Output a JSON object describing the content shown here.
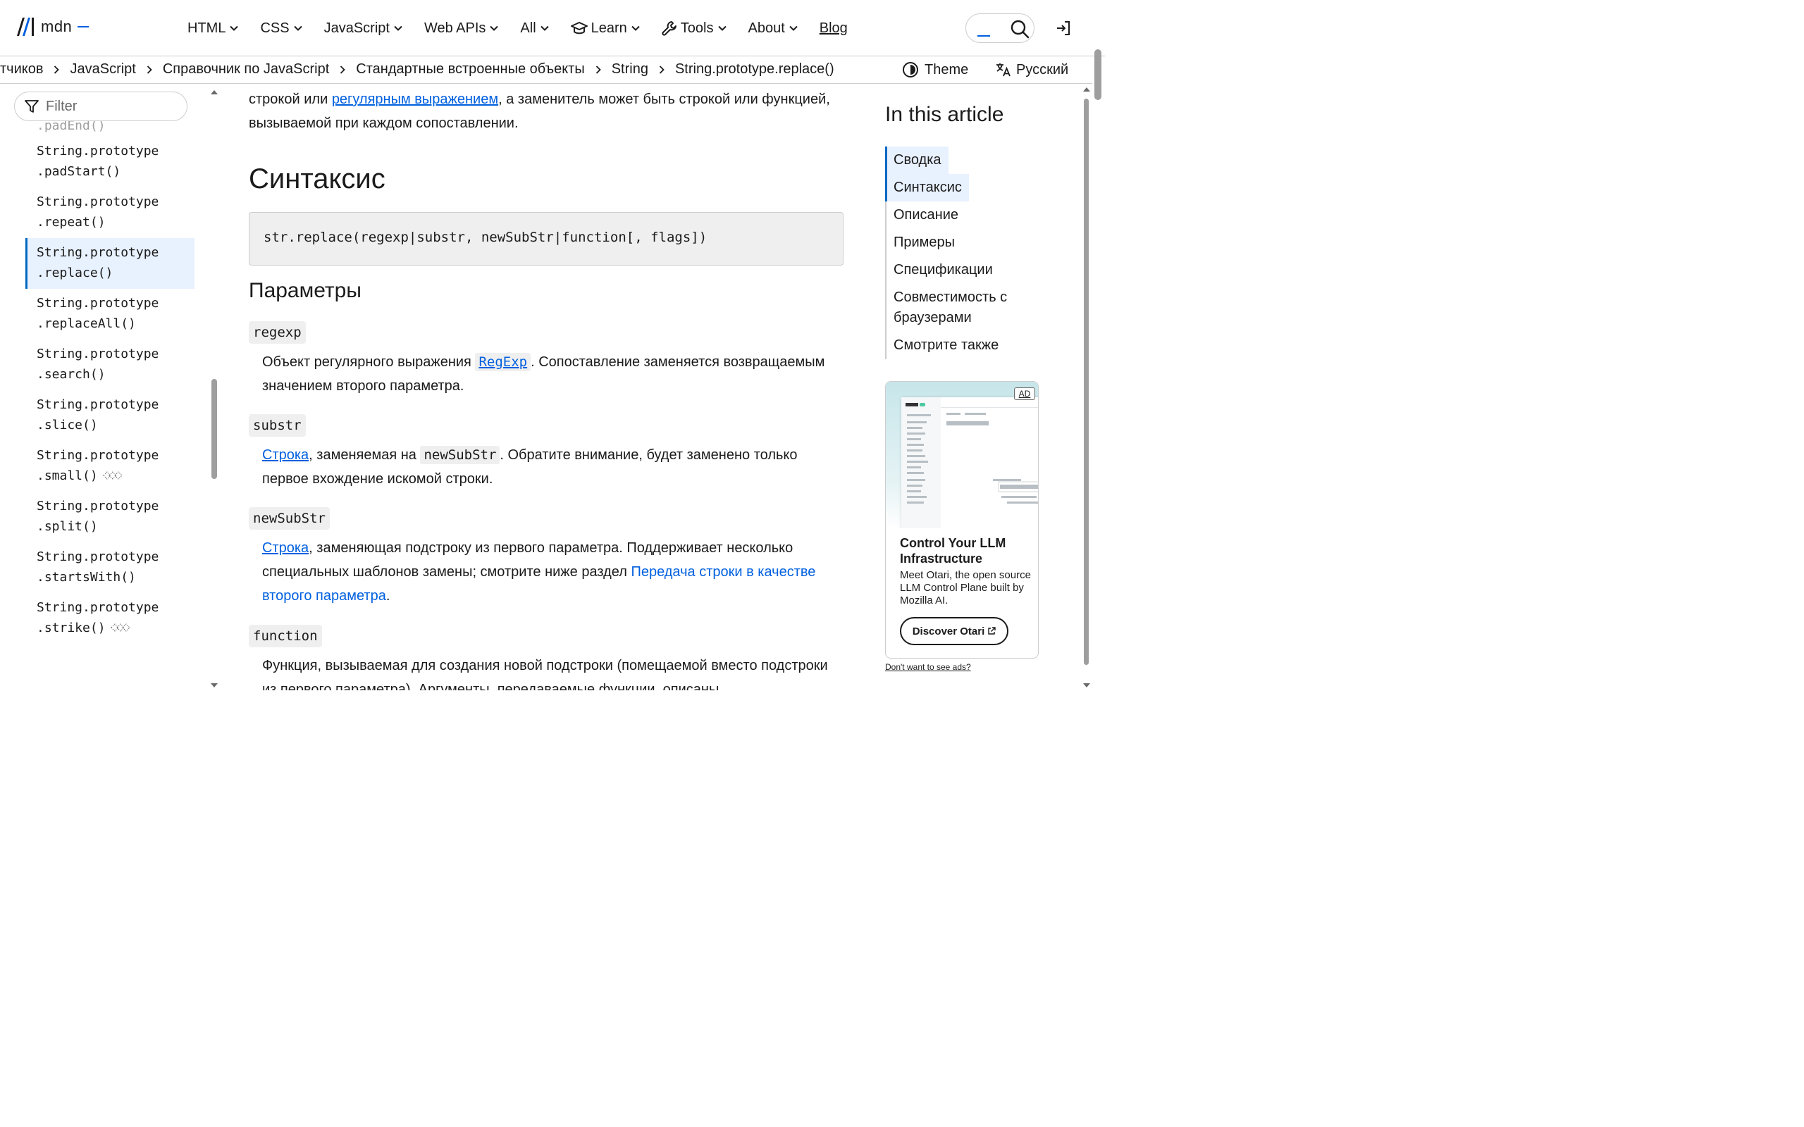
{
  "nav": {
    "logo_text": "mdn",
    "menu": [
      {
        "label": "HTML"
      },
      {
        "label": "CSS"
      },
      {
        "label": "JavaScript"
      },
      {
        "label": "Web APIs"
      },
      {
        "label": "All"
      },
      {
        "label": "Learn"
      },
      {
        "label": "Tools"
      },
      {
        "label": "About"
      }
    ],
    "blog": "Blog"
  },
  "breadcrumbs": [
    "тчиков",
    "JavaScript",
    "Справочник по JavaScript",
    "Стандартные встроенные объекты",
    "String",
    "String.prototype.replace()"
  ],
  "theme_label": "Theme",
  "language_label": "Русский",
  "sidebar": {
    "filter_placeholder": "Filter",
    "partial_item": ".padEnd()",
    "items": [
      {
        "line1": "String.prototype",
        "line2": ".padStart()"
      },
      {
        "line1": "String.prototype",
        "line2": ".repeat()"
      },
      {
        "line1": "String.prototype",
        "line2": ".replace()"
      },
      {
        "line1": "String.prototype",
        "line2": ".replaceAll()"
      },
      {
        "line1": "String.prototype",
        "line2": ".search()"
      },
      {
        "line1": "String.prototype",
        "line2": ".slice()"
      },
      {
        "line1": "String.prototype",
        "line2": ".small()"
      },
      {
        "line1": "String.prototype",
        "line2": ".split()"
      },
      {
        "line1": "String.prototype",
        "line2": ".startsWith()"
      },
      {
        "line1": "String.prototype",
        "line2": ".strike()"
      }
    ],
    "active_index": 2
  },
  "content": {
    "intro_before": "строкой или ",
    "intro_link": "регулярным выражением",
    "intro_after": ", а заменитель может быть строкой или функцией, вызываемой при каждом сопоставлении.",
    "syntax_heading": "Синтаксис",
    "syntax_code": "str.replace(regexp|substr, newSubStr|function[, flags])",
    "params_heading": "Параметры",
    "regexp_term": "regexp",
    "regexp_before": "Объект регулярного выражения ",
    "regexp_link": "RegExp",
    "regexp_after": ". Сопоставление заменяется возвращаемым значением второго параметра.",
    "substr_term": "substr",
    "substr_link": "Строка",
    "substr_mid": ", заменяемая на ",
    "substr_code": "newSubStr",
    "substr_after": ". Обратите внимание, будет заменено только первое вхождение искомой строки.",
    "newsubstr_term": "newSubStr",
    "newsubstr_link": "Строка",
    "newsubstr_mid": ", заменяющая подстроку из первого параметра. Поддерживает несколько специальных шаблонов замены; смотрите ниже раздел ",
    "newsubstr_link2": "Передача строки в качестве второго параметра",
    "newsubstr_end": ".",
    "function_term": "function",
    "function_text": "Функция, вызываемая для создания новой подстроки (помещаемой вместо подстроки из первого параметра). Аргументы, передаваемые функции, описаны"
  },
  "toc": {
    "title": "In this article",
    "items": [
      "Сводка",
      "Синтаксис",
      "Описание",
      "Примеры",
      "Спецификации",
      "Совместимость с браузерами",
      "Смотрите также"
    ]
  },
  "ad": {
    "badge": "AD",
    "title": "Control Your LLM Infrastructure",
    "description": "Meet Otari, the open source LLM Control Plane built by Mozilla AI.",
    "button": "Discover Otari",
    "no_ads": "Don't want to see ads?"
  }
}
